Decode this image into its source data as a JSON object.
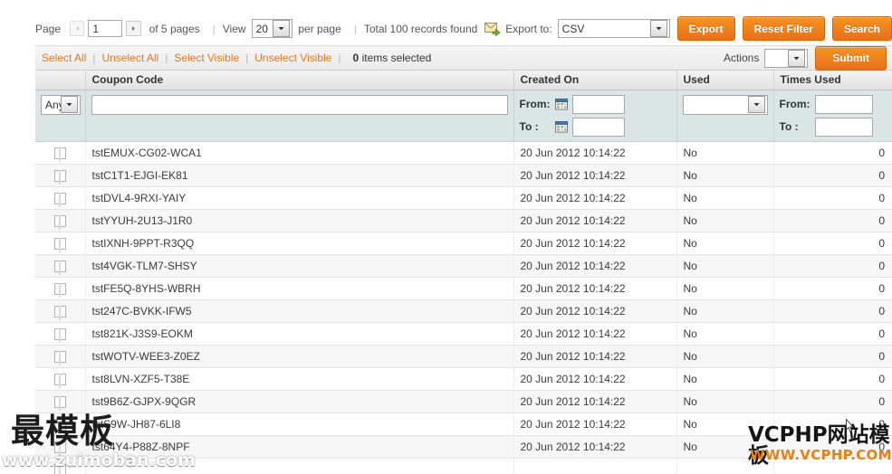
{
  "pager": {
    "page_label": "Page",
    "page_value": "1",
    "of_pages": "of 5 pages",
    "sep": "|",
    "view_label": "View",
    "view_value": "20",
    "per_page_label": "per page",
    "total_records": "Total 100 records found",
    "export_to_label": "Export to:",
    "export_format": "CSV",
    "export_button": "Export",
    "reset_filter_button": "Reset Filter",
    "search_button": "Search",
    "prev_arrow_icon": "caret-left-icon",
    "next_arrow_icon": "caret-right-icon",
    "export_icon": "export-envelope-icon",
    "dropdown_icon": "chevron-down-icon"
  },
  "selection_bar": {
    "select_all": "Select All",
    "unselect_all": "Unselect All",
    "select_visible": "Select Visible",
    "unselect_visible": "Unselect Visible",
    "sep": "|",
    "items_selected_count": "0",
    "items_selected_label": "items selected",
    "actions_label": "Actions",
    "actions_value": "",
    "submit_button": "Submit"
  },
  "grid": {
    "columns": [
      {
        "key": "checkbox",
        "label": ""
      },
      {
        "key": "coupon_code",
        "label": "Coupon Code"
      },
      {
        "key": "created_on",
        "label": "Created On"
      },
      {
        "key": "used",
        "label": "Used"
      },
      {
        "key": "times_used",
        "label": "Times Used"
      }
    ],
    "filters": {
      "select_any": "Any",
      "coupon_code_value": "",
      "created_from_label": "From:",
      "created_to_label": "To :",
      "created_from_value": "",
      "created_to_value": "",
      "calendar_icon": "calendar-icon",
      "used_value": "",
      "times_from_label": "From:",
      "times_to_label": "To :",
      "times_from_value": "",
      "times_to_value": ""
    },
    "rows": [
      {
        "coupon_code": "tstEMUX-CG02-WCA1",
        "created_on": "20 Jun 2012 10:14:22",
        "used": "No",
        "times_used": "0"
      },
      {
        "coupon_code": "tstC1T1-EJGI-EK81",
        "created_on": "20 Jun 2012 10:14:22",
        "used": "No",
        "times_used": "0"
      },
      {
        "coupon_code": "tstDVL4-9RXI-YAIY",
        "created_on": "20 Jun 2012 10:14:22",
        "used": "No",
        "times_used": "0"
      },
      {
        "coupon_code": "tstYYUH-2U13-J1R0",
        "created_on": "20 Jun 2012 10:14:22",
        "used": "No",
        "times_used": "0"
      },
      {
        "coupon_code": "tstIXNH-9PPT-R3QQ",
        "created_on": "20 Jun 2012 10:14:22",
        "used": "No",
        "times_used": "0"
      },
      {
        "coupon_code": "tst4VGK-TLM7-SHSY",
        "created_on": "20 Jun 2012 10:14:22",
        "used": "No",
        "times_used": "0"
      },
      {
        "coupon_code": "tstFE5Q-8YHS-WBRH",
        "created_on": "20 Jun 2012 10:14:22",
        "used": "No",
        "times_used": "0"
      },
      {
        "coupon_code": "tst247C-BVKK-IFW5",
        "created_on": "20 Jun 2012 10:14:22",
        "used": "No",
        "times_used": "0"
      },
      {
        "coupon_code": "tst821K-J3S9-EOKM",
        "created_on": "20 Jun 2012 10:14:22",
        "used": "No",
        "times_used": "0"
      },
      {
        "coupon_code": "tstWOTV-WEE3-Z0EZ",
        "created_on": "20 Jun 2012 10:14:22",
        "used": "No",
        "times_used": "0"
      },
      {
        "coupon_code": "tst8LVN-XZF5-T38E",
        "created_on": "20 Jun 2012 10:14:22",
        "used": "No",
        "times_used": "0"
      },
      {
        "coupon_code": "tst9B6Z-GJPX-9QGR",
        "created_on": "20 Jun 2012 10:14:22",
        "used": "No",
        "times_used": "0"
      },
      {
        "coupon_code": "tstS9W-JH87-6LI8",
        "created_on": "20 Jun 2012 10:14:22",
        "used": "No",
        "times_used": "0"
      },
      {
        "coupon_code": "tst64Y4-P88Z-8NPF",
        "created_on": "20 Jun 2012 10:14:22",
        "used": "No",
        "times_used": "0"
      },
      {
        "coupon_code": "",
        "created_on": "",
        "used": "",
        "times_used": ""
      }
    ]
  },
  "watermarks": {
    "left_cn": "最模板",
    "left_url": "www.zuimoban.com",
    "right_cn": "VCPHP网站模板",
    "right_url": "WWW.VCPHP.COM"
  },
  "colors": {
    "accent_orange": "#e8820f",
    "button_orange": "#f0791b",
    "filter_row_bg": "#dbe5e5",
    "header_bg": "#e8e8e8"
  }
}
